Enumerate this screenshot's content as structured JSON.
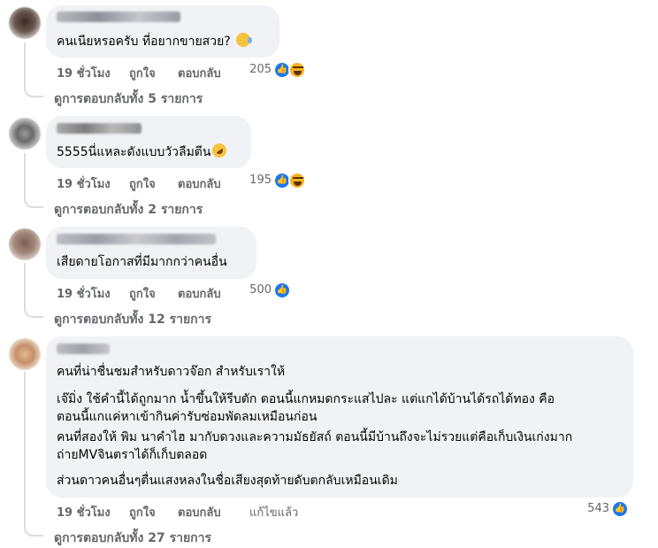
{
  "comments": [
    {
      "text": "คนเนียหรอครับ ที่อยากขายสวย?",
      "emoji": "sad-relieved-face",
      "time": "19 ชั่วโมง",
      "like": "ถูกใจ",
      "reply": "ตอบกลับ",
      "reaction_count": "205",
      "reactions": [
        "like-icon",
        "haha-icon"
      ],
      "view_replies": "ดูการตอบกลับทั้ง 5 รายการ"
    },
    {
      "text": "5555นี่แหละดังแบบวัวลืมตีน",
      "emoji": "rolling-laughing-face",
      "time": "19 ชั่วโมง",
      "like": "ถูกใจ",
      "reply": "ตอบกลับ",
      "reaction_count": "195",
      "reactions": [
        "like-icon",
        "haha-icon"
      ],
      "view_replies": "ดูการตอบกลับทั้ง 2 รายการ"
    },
    {
      "text": "เสียดายโอกาสที่มีมากกว่าคนอื่น",
      "time": "19 ชั่วโมง",
      "like": "ถูกใจ",
      "reply": "ตอบกลับ",
      "reaction_count": "500",
      "reactions": [
        "like-icon"
      ],
      "view_replies": "ดูการตอบกลับทั้ง 12 รายการ"
    },
    {
      "lines": [
        "คนที่น่าชื่นชมสำหรับดาวจ๊อก สำหรับเราให้",
        "เจ๊มิ่ง ใช้คำนี้ได้ถูกมาก น้ำขึ้นให้รีบตัก ตอนนี้แกหมดกระแสไปละ แต่แกได้บ้านได้รถได้ทอง คือ",
        "ตอนนี้แกแค่หาเข้ากินค่ารับซ่อมพัดลมเหมือนก่อน",
        "คนที่สองให้ พิม นาคำไฮ มากับดวงและความมัธยัสถ์ ตอนนี้มีบ้านถึงจะไม่รวยแต่คือเก็บเงินเก่งมาก",
        "ถ่ายMVจินตราได้ก็เก็บตลอด",
        "ส่วนดาวคนอื่นๆตื่นแสงหลงในชื่อเสียงสุดท้ายดับตกลับเหมือนเดิม"
      ],
      "time": "19 ชั่วโมง",
      "like": "ถูกใจ",
      "reply": "ตอบกลับ",
      "edited": "แก้ไขแล้ว",
      "reaction_count": "543",
      "reactions": [
        "like-icon"
      ],
      "view_replies": "ดูการตอบกลับทั้ง 27 รายการ"
    }
  ],
  "colors": {
    "bubble": "#f0f2f5",
    "secondary_text": "#65676b",
    "like_blue": "#1877f2",
    "haha_yellow": "#f7b125"
  }
}
